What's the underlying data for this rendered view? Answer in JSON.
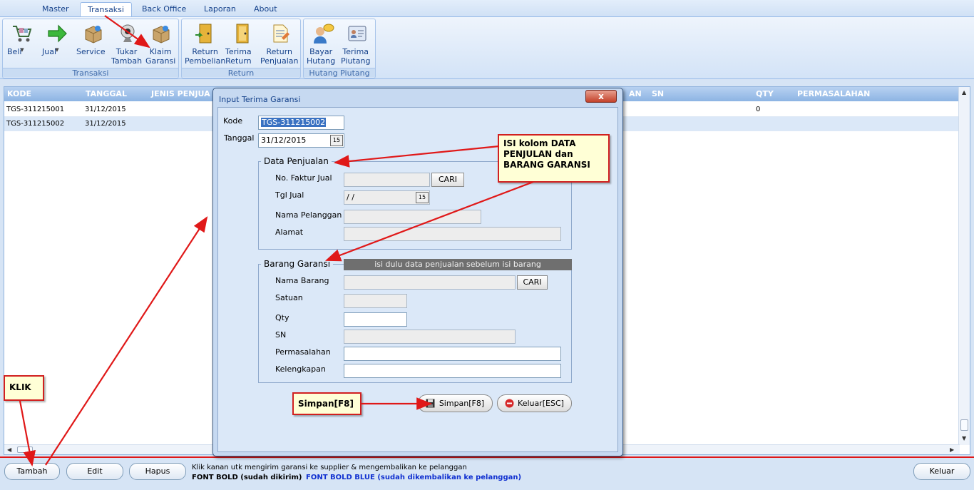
{
  "menu": {
    "tabs": [
      "Master",
      "Transaksi",
      "Back Office",
      "Laporan",
      "About"
    ],
    "active": "Transaksi"
  },
  "ribbon": {
    "groups": [
      {
        "label": "Transaksi",
        "buttons": [
          "Beli",
          "Jual",
          "Service",
          "Tukar\nTambah",
          "Klaim\nGaransi"
        ]
      },
      {
        "label": "Return",
        "buttons": [
          "Return\nPembelian",
          "Terima\nReturn",
          "Return\nPenjualan"
        ]
      },
      {
        "label": "Hutang Piutang",
        "buttons": [
          "Bayar\nHutang",
          "Terima\nPiutang"
        ]
      }
    ],
    "icons": [
      "cart-icon",
      "green-arrow-icon",
      "box-icon",
      "webcam-icon",
      "box-icon",
      "door-return-icon",
      "door-receive-icon",
      "document-icon",
      "person-speech-icon",
      "id-card-icon"
    ]
  },
  "grid": {
    "headers": [
      "KODE",
      "TANGGAL",
      "JENIS PENJUA",
      "AN",
      "SN",
      "QTY",
      "PERMASALAHAN"
    ],
    "rows": [
      {
        "kode": "TGS-311215001",
        "tanggal": "31/12/2015",
        "qty": "0"
      },
      {
        "kode": "TGS-311215002",
        "tanggal": "31/12/2015",
        "qty": ""
      }
    ]
  },
  "dialog": {
    "title": "Input Terima Garansi",
    "close": "x",
    "kode_label": "Kode",
    "kode_value": "TGS-311215002",
    "tanggal_label": "Tanggal",
    "tanggal_value": "31/12/2015",
    "data_penjualan": {
      "legend": "Data Penjualan",
      "faktur_label": "No. Faktur Jual",
      "cari": "CARI",
      "tgl_label": "Tgl Jual",
      "tgl_value": " /  /",
      "pelanggan_label": "Nama Pelanggan",
      "alamat_label": "Alamat"
    },
    "barang_garansi": {
      "legend": "Barang Garansi",
      "banner": "isi dulu data penjualan sebelum isi barang",
      "nama_label": "Nama Barang",
      "cari": "CARI",
      "satuan_label": "Satuan",
      "qty_label": "Qty",
      "sn_label": "SN",
      "permasalahan_label": "Permasalahan",
      "kelengkapan_label": "Kelengkapan"
    },
    "simpan": "Simpan[F8]",
    "keluar": "Keluar[ESC]"
  },
  "bottom": {
    "tambah": "Tambah",
    "edit": "Edit",
    "hapus": "Hapus",
    "keluar": "Keluar",
    "hint1": "Klik kanan utk mengirim garansi ke supplier & mengembalikan ke pelanggan",
    "hint2": "FONT BOLD (sudah dikirim)",
    "hint3": "FONT BOLD BLUE (sudah dikembalikan ke pelanggan)"
  },
  "annotations": {
    "klik": "KLIK",
    "isi": "ISI kolom DATA\nPENJULAN dan\nBARANG GARANSI",
    "simpan": "Simpan[F8]"
  },
  "colors": {
    "accent": "#15428b",
    "annotation_red": "#d12020",
    "annotation_fill": "#ffffd6"
  }
}
